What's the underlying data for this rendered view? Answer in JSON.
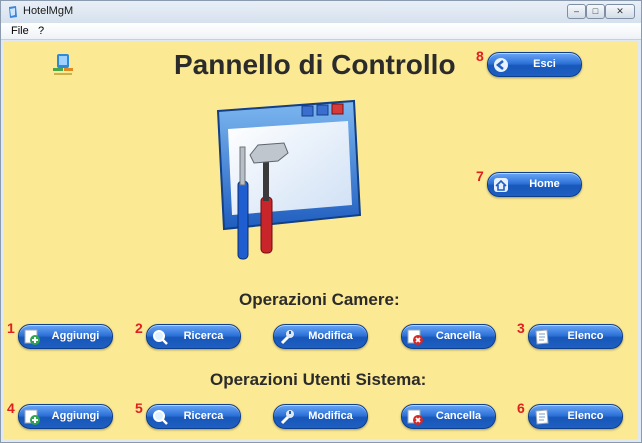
{
  "window": {
    "title": "HotelMgM"
  },
  "menu": {
    "file": "File",
    "help": "?"
  },
  "logo": {
    "text": "Hotel"
  },
  "page_title": "Pannello di Controllo",
  "top_buttons": [
    {
      "number": "8",
      "label": "Esci",
      "icon": "exit-icon"
    },
    {
      "number": "7",
      "label": "Home",
      "icon": "home-icon"
    }
  ],
  "sections": [
    {
      "title": "Operazioni Camere:",
      "buttons": [
        {
          "number": "1",
          "label": "Aggiungi",
          "icon": "add-icon"
        },
        {
          "number": "2",
          "label": "Ricerca",
          "icon": "search-icon"
        },
        {
          "number": "",
          "label": "Modifica",
          "icon": "wrench-icon"
        },
        {
          "number": "",
          "label": "Cancella",
          "icon": "delete-icon"
        },
        {
          "number": "3",
          "label": "Elenco",
          "icon": "list-icon"
        }
      ]
    },
    {
      "title": "Operazioni Utenti Sistema:",
      "buttons": [
        {
          "number": "4",
          "label": "Aggiungi",
          "icon": "add-icon"
        },
        {
          "number": "5",
          "label": "Ricerca",
          "icon": "search-icon"
        },
        {
          "number": "",
          "label": "Modifica",
          "icon": "wrench-icon"
        },
        {
          "number": "",
          "label": "Cancella",
          "icon": "delete-icon"
        },
        {
          "number": "6",
          "label": "Elenco",
          "icon": "list-icon"
        }
      ]
    }
  ],
  "colors": {
    "background": "#fbe993",
    "button": "#2f73d9",
    "number": "#e02020"
  }
}
